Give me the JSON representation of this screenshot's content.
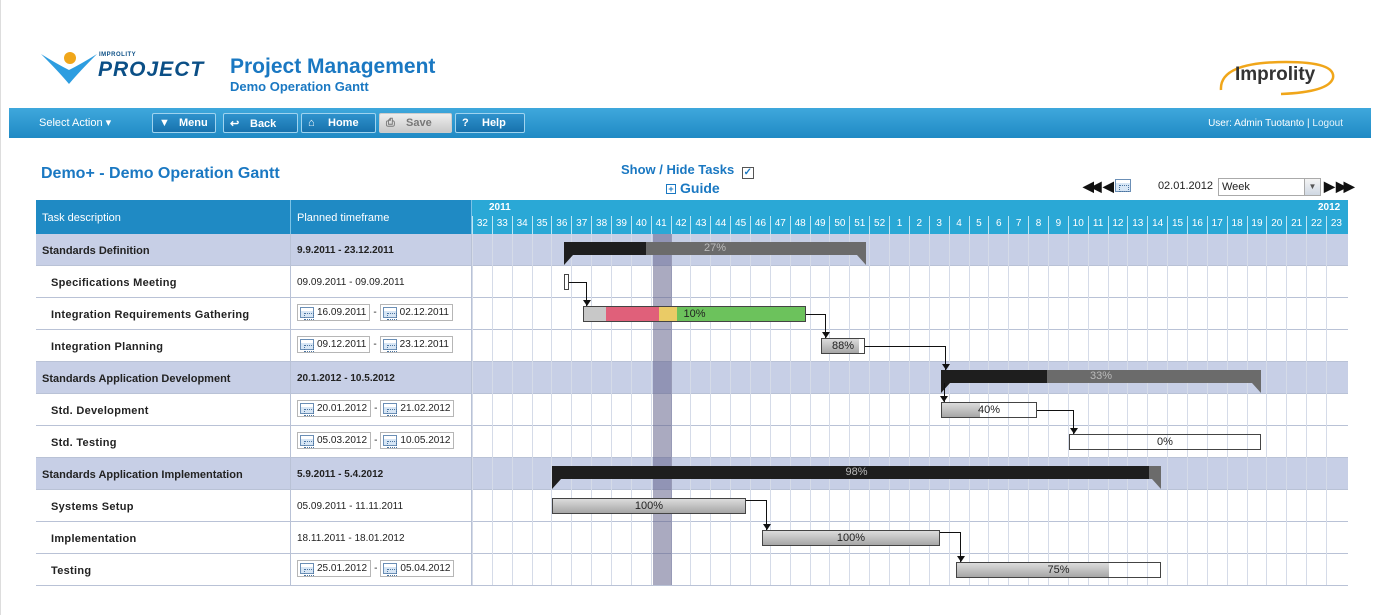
{
  "header": {
    "logo_small": "IMPROLITY",
    "logo_big": "PROJECT",
    "title": "Project Management",
    "subtitle": "Demo Operation Gantt",
    "brand": "Improlity"
  },
  "nav": {
    "select_action": "Select Action ▾",
    "menu": "Menu",
    "back": "Back",
    "home": "Home",
    "save": "Save",
    "help": "Help",
    "user_label": "User: Admin Tuotanto",
    "separator": "|",
    "logout": "Logout"
  },
  "toolbar": {
    "gantt_title": "Demo+ - Demo Operation Gantt",
    "show_hide": "Show / Hide Tasks",
    "show_hide_checked": "✓",
    "guide": "Guide",
    "date": "02.01.2012",
    "period": "Week"
  },
  "grid": {
    "col_task": "Task description",
    "col_time": "Planned timeframe",
    "year_2011": "2011",
    "year_2012": "2012",
    "weeks": [
      "32",
      "33",
      "34",
      "35",
      "36",
      "37",
      "38",
      "39",
      "40",
      "41",
      "42",
      "43",
      "44",
      "45",
      "46",
      "47",
      "48",
      "49",
      "50",
      "51",
      "52",
      "1",
      "2",
      "3",
      "4",
      "5",
      "6",
      "7",
      "8",
      "9",
      "10",
      "11",
      "12",
      "13",
      "14",
      "15",
      "16",
      "17",
      "18",
      "19",
      "20",
      "21",
      "22",
      "23"
    ],
    "rows": [
      {
        "type": "group",
        "name": "Standards Definition",
        "start": "9.9.2011",
        "end": "23.12.2011",
        "editable": false
      },
      {
        "type": "task",
        "name": "Specifications Meeting",
        "start": "09.09.2011",
        "end": "09.09.2011",
        "editable": false
      },
      {
        "type": "task",
        "name": "Integration Requirements Gathering",
        "start": "16.09.2011",
        "end": "02.12.2011",
        "editable": true
      },
      {
        "type": "task",
        "name": "Integration Planning",
        "start": "09.12.2011",
        "end": "23.12.2011",
        "editable": true
      },
      {
        "type": "group",
        "name": "Standards Application Development",
        "start": "20.1.2012",
        "end": "10.5.2012",
        "editable": false
      },
      {
        "type": "task",
        "name": "Std. Development",
        "start": "20.01.2012",
        "end": "21.02.2012",
        "editable": true
      },
      {
        "type": "task",
        "name": "Std. Testing",
        "start": "05.03.2012",
        "end": "10.05.2012",
        "editable": true
      },
      {
        "type": "group",
        "name": "Standards Application Implementation",
        "start": "5.9.2011",
        "end": "5.4.2012",
        "editable": false
      },
      {
        "type": "task",
        "name": "Systems Setup",
        "start": "05.09.2011",
        "end": "11.11.2011",
        "editable": false
      },
      {
        "type": "task",
        "name": "Implementation",
        "start": "18.11.2011",
        "end": "18.01.2012",
        "editable": false
      },
      {
        "type": "task",
        "name": "Testing",
        "start": "25.01.2012",
        "end": "05.04.2012",
        "editable": true
      }
    ],
    "date_separator": "-",
    "progress": {
      "standards_definition": "27%",
      "integration_requirements": "10%",
      "integration_planning": "88%",
      "standards_app_dev": "33%",
      "std_development": "40%",
      "std_testing": "0%",
      "standards_app_impl": "98%",
      "systems_setup": "100%",
      "implementation": "100%",
      "testing": "75%"
    },
    "colors": {
      "header_blue": "#1f8ac4",
      "group_row": "#c7cfe6",
      "late_red": "#e0607a",
      "warn_yellow": "#eacb66",
      "ok_green": "#6cc25c"
    }
  }
}
